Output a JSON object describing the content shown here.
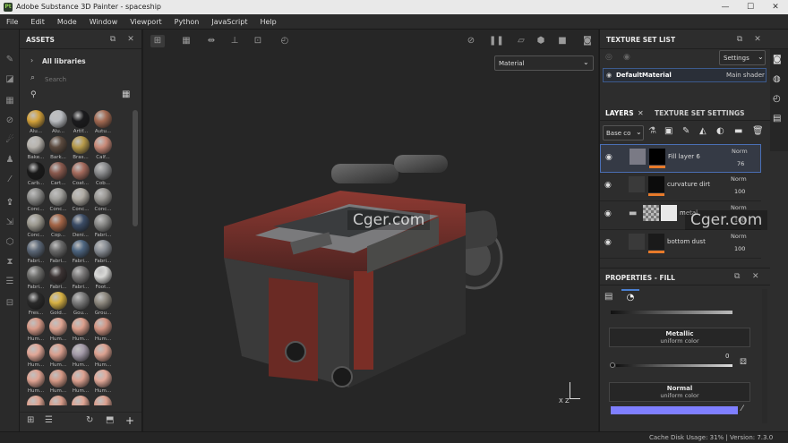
{
  "titlebar": {
    "title": "Adobe Substance 3D Painter - spaceship",
    "app_icon": "Pt",
    "minimize": "—",
    "maximize": "☐",
    "close": "✕"
  },
  "menu": [
    "File",
    "Edit",
    "Mode",
    "Window",
    "Viewport",
    "Python",
    "JavaScript",
    "Help"
  ],
  "assets": {
    "title": "ASSETS",
    "libraries": "All libraries",
    "search_placeholder": "Search",
    "swatches": [
      {
        "label": "Alu...",
        "color": "#d4a23a"
      },
      {
        "label": "Alu...",
        "color": "#b9bcc0"
      },
      {
        "label": "Artif...",
        "color": "#1b1b1d"
      },
      {
        "label": "Autu...",
        "color": "#a46a52"
      },
      {
        "label": "Bake...",
        "color": "#b8b4ae"
      },
      {
        "label": "Bark...",
        "color": "#5b4a3e"
      },
      {
        "label": "Bras...",
        "color": "#b79a4a"
      },
      {
        "label": "Calf...",
        "color": "#c98a78"
      },
      {
        "label": "Carb...",
        "color": "#1a1a1a"
      },
      {
        "label": "Cart...",
        "color": "#8a5a4e"
      },
      {
        "label": "Coat...",
        "color": "#a56b5d"
      },
      {
        "label": "Cob...",
        "color": "#8b8c8e"
      },
      {
        "label": "Conc...",
        "color": "#8c8c8a"
      },
      {
        "label": "Conc...",
        "color": "#a1a09c"
      },
      {
        "label": "Conc...",
        "color": "#b0aca4"
      },
      {
        "label": "Conc...",
        "color": "#9a9894"
      },
      {
        "label": "Conc...",
        "color": "#9d9a90"
      },
      {
        "label": "Cop...",
        "color": "#a46547"
      },
      {
        "label": "Deni...",
        "color": "#3b4c66"
      },
      {
        "label": "Fabri...",
        "color": "#8a8a88"
      },
      {
        "label": "Fabri...",
        "color": "#5c6878"
      },
      {
        "label": "Fabri...",
        "color": "#6a6a6a"
      },
      {
        "label": "Fabri...",
        "color": "#4d6580"
      },
      {
        "label": "Fabri...",
        "color": "#8a8f96"
      },
      {
        "label": "Fabri...",
        "color": "#6e6e6c"
      },
      {
        "label": "Fabri...",
        "color": "#3a3232"
      },
      {
        "label": "Fabri...",
        "color": "#7a7878"
      },
      {
        "label": "Foot...",
        "color": "#d8d8d6"
      },
      {
        "label": "Fres...",
        "color": "#2a2a2a"
      },
      {
        "label": "Gold...",
        "color": "#d7b143"
      },
      {
        "label": "Gou...",
        "color": "#7c7c7c"
      },
      {
        "label": "Grou...",
        "color": "#8f8a80"
      },
      {
        "label": "Hum...",
        "color": "#d89a88"
      },
      {
        "label": "Hum...",
        "color": "#e0a593"
      },
      {
        "label": "Hum...",
        "color": "#dc9f8c"
      },
      {
        "label": "Hum...",
        "color": "#d49583"
      },
      {
        "label": "Hum...",
        "color": "#e2a797"
      },
      {
        "label": "Hum...",
        "color": "#d99e8d"
      },
      {
        "label": "Hum...",
        "color": "#a39aa8"
      },
      {
        "label": "Hum...",
        "color": "#dca190"
      },
      {
        "label": "Hum...",
        "color": "#e0a392"
      },
      {
        "label": "Hum...",
        "color": "#d69986"
      },
      {
        "label": "Hum...",
        "color": "#dda190"
      },
      {
        "label": "Hum...",
        "color": "#e3a999"
      },
      {
        "label": "",
        "color": "#dfa492"
      },
      {
        "label": "",
        "color": "#d89c8a"
      },
      {
        "label": "",
        "color": "#e0a594"
      },
      {
        "label": "",
        "color": "#dba08f"
      }
    ]
  },
  "viewport": {
    "material_select": "Material",
    "axis_label": "X Z"
  },
  "texture_set_list": {
    "title": "TEXTURE SET LIST",
    "settings": "Settings",
    "item": "DefaultMaterial",
    "shader": "Main shader"
  },
  "layers": {
    "tab_layers": "LAYERS",
    "tab_settings": "TEXTURE SET SETTINGS",
    "channel": "Base co",
    "rows": [
      {
        "name": "Fill layer 6",
        "blend": "Norm",
        "opacity": "76"
      },
      {
        "name": "curvature dirt",
        "blend": "Norm",
        "opacity": "100"
      },
      {
        "name": "metal",
        "blend": "Norm",
        "opacity": "100"
      },
      {
        "name": "bottom dust",
        "blend": "Norm",
        "opacity": "100"
      }
    ]
  },
  "properties": {
    "title": "PROPERTIES - FILL",
    "metallic_title": "Metallic",
    "metallic_sub": "uniform color",
    "metallic_value": "0",
    "normal_title": "Normal",
    "normal_sub": "uniform color",
    "normal_color": "#7f7fff"
  },
  "status": {
    "text": "Cache Disk Usage: 31% | Version: 7.3.0"
  },
  "watermark": {
    "text": "Cger.com"
  }
}
